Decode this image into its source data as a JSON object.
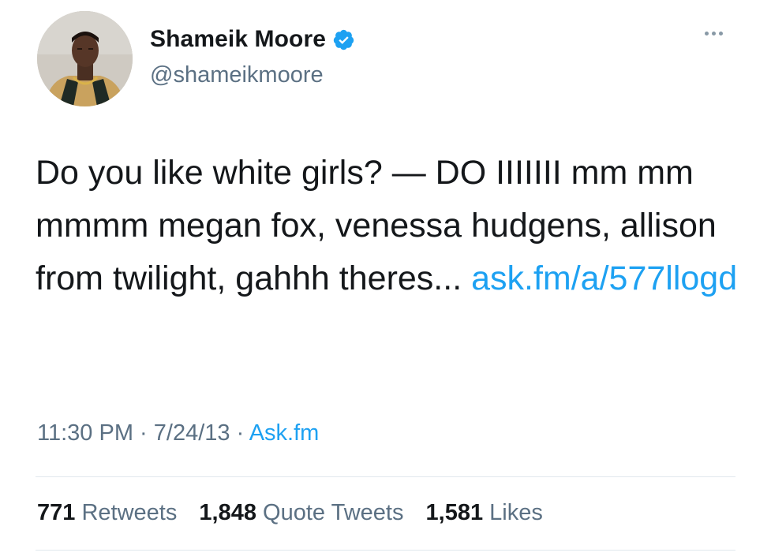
{
  "author": {
    "display_name": "Shameik Moore",
    "handle": "@shameikmoore",
    "verified": true,
    "verified_icon": "verified-badge-icon",
    "more_icon": "more-options-icon"
  },
  "tweet": {
    "text": "Do you like white girls? — DO IIIIIII mm mm mmmm megan fox, venessa hudgens, allison from twilight, gahhh theres... ",
    "link": "ask.fm/a/577llogd",
    "time": "11:30 PM",
    "date": "7/24/13",
    "source": "Ask.fm"
  },
  "stats": {
    "retweets_count": "771",
    "retweets_label": "Retweets",
    "quotes_count": "1,848",
    "quotes_label": "Quote Tweets",
    "likes_count": "1,581",
    "likes_label": "Likes"
  },
  "colors": {
    "link": "#1da1f2",
    "secondary_text": "#5b7083",
    "primary_text": "#14171a",
    "divider": "#e1e8ed"
  }
}
